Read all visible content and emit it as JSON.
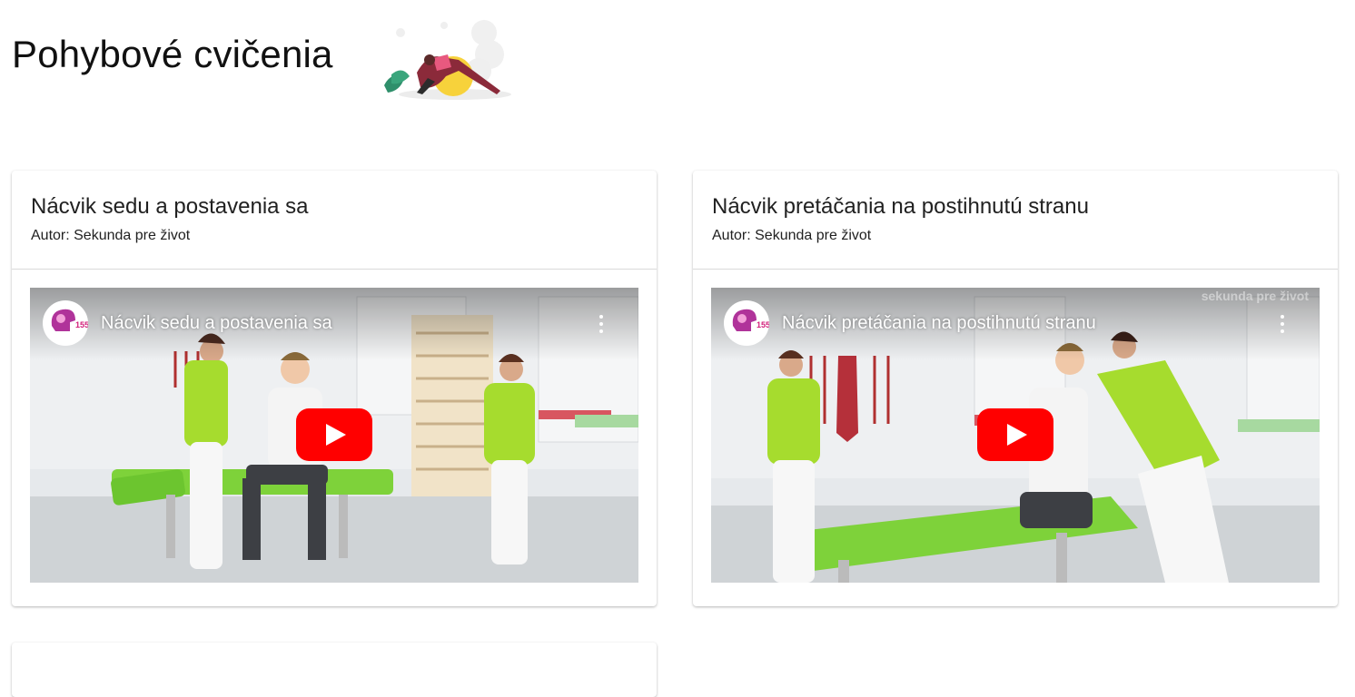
{
  "page": {
    "title": "Pohybové cvičenia",
    "hero_illustration": "woman-stretching-on-exercise-ball"
  },
  "cards": [
    {
      "title": "Nácvik sedu a postavenia sa",
      "author": "Autor: Sekunda pre život",
      "video": {
        "title": "Nácvik sedu a postavenia sa",
        "channel_logo": "brain-logo-155",
        "play_icon": "youtube-play-icon",
        "menu_icon": "more-vert-icon"
      }
    },
    {
      "title": "Nácvik pretáčania na postihnutú stranu",
      "author": "Autor: Sekunda pre život",
      "video": {
        "title": "Nácvik pretáčania na postihnutú stranu",
        "channel_logo": "brain-logo-155",
        "play_icon": "youtube-play-icon",
        "menu_icon": "more-vert-icon",
        "watermark": "sekunda pre život"
      }
    }
  ],
  "colors": {
    "youtube_red": "#ff0000",
    "scrubs_green": "#a6dc2e",
    "table_green": "#7fd33c"
  }
}
